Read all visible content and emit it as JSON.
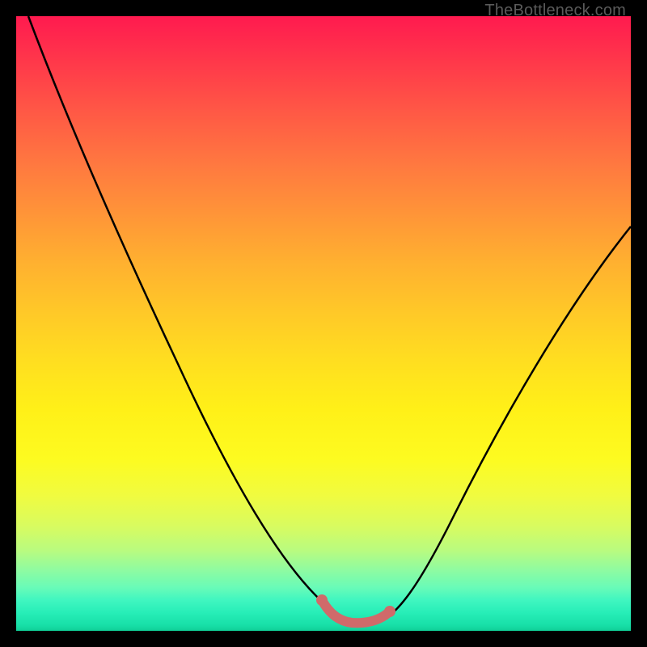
{
  "watermark": "TheBottleneck.com",
  "colors": {
    "frame": "#000000",
    "curve_stroke": "#000000",
    "highlight_stroke": "#d06a6a",
    "gradient_top": "#ff1a4f",
    "gradient_bottom": "#10d098"
  },
  "chart_data": {
    "type": "line",
    "title": "",
    "xlabel": "",
    "ylabel": "",
    "xlim": [
      0,
      100
    ],
    "ylim": [
      0,
      100
    ],
    "grid": false,
    "legend": false,
    "series": [
      {
        "name": "bottleneck-curve",
        "x": [
          2,
          10,
          20,
          30,
          40,
          48,
          52,
          56,
          60,
          64,
          70,
          80,
          90,
          100
        ],
        "y": [
          100,
          82,
          63,
          45,
          28,
          12,
          5,
          1,
          1,
          3,
          12,
          32,
          50,
          65
        ]
      }
    ],
    "highlight_segment": {
      "name": "optimal-range",
      "x": [
        52,
        54,
        56,
        58,
        60,
        62
      ],
      "y": [
        5,
        2,
        1,
        1,
        1,
        3
      ]
    }
  }
}
